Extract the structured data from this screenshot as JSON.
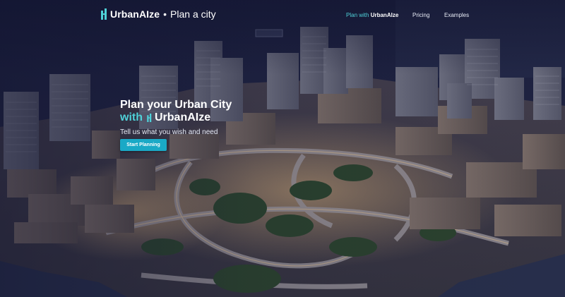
{
  "header": {
    "brand_name_prefix": "Urban",
    "brand_name_suffix": "AIze",
    "brand_separator": "•",
    "brand_tagline": "Plan a city",
    "nav": {
      "plan_prefix": "Plan with",
      "plan_brand_prefix": "Urban",
      "plan_brand_suffix": "AIze",
      "pricing": "Pricing",
      "examples": "Examples"
    }
  },
  "hero": {
    "title_line1": "Plan your Urban City",
    "title_with": "with",
    "title_brand_prefix": "Urban",
    "title_brand_suffix": "AIze",
    "subtitle": "Tell us what you wish and need",
    "cta_label": "Start Planning"
  },
  "colors": {
    "accent": "#4fd1d8",
    "button": "#1aa9c6",
    "background": "#1b1f3a"
  },
  "icons": {
    "logo": "urbanaize-logo-icon",
    "background": "aerial-city-image"
  }
}
